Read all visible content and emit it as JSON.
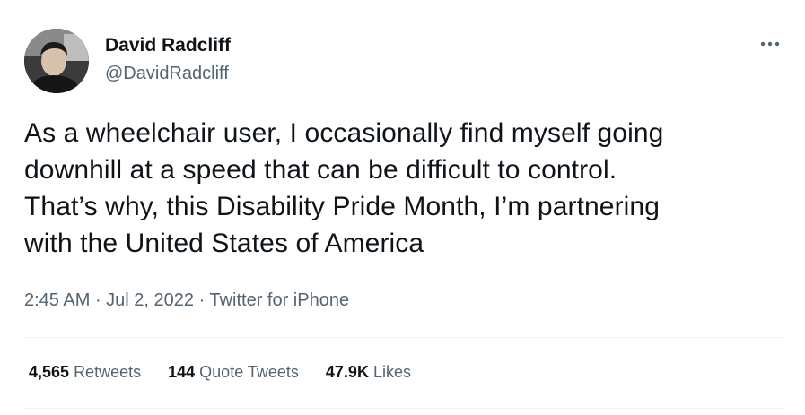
{
  "author": {
    "name": "David Radcliff",
    "handle": "@DavidRadcliff"
  },
  "tweet": {
    "text": "As a wheelchair user, I occasionally find myself going\ndownhill at a speed that can be difficult to control.\nThat’s why, this Disability Pride Month, I’m partnering\nwith the United States of America",
    "time": "2:45 AM",
    "date": "Jul 2, 2022",
    "source": "Twitter for iPhone",
    "separator": " · "
  },
  "stats": {
    "retweets_count": "4,565",
    "retweets_label": "Retweets",
    "quotes_count": "144",
    "quotes_label": "Quote Tweets",
    "likes_count": "47.9K",
    "likes_label": "Likes"
  },
  "icons": {
    "more": "more-horizontal-icon"
  },
  "colors": {
    "text_primary": "#0f1419",
    "text_secondary": "#536471",
    "divider": "#eff3f4"
  }
}
